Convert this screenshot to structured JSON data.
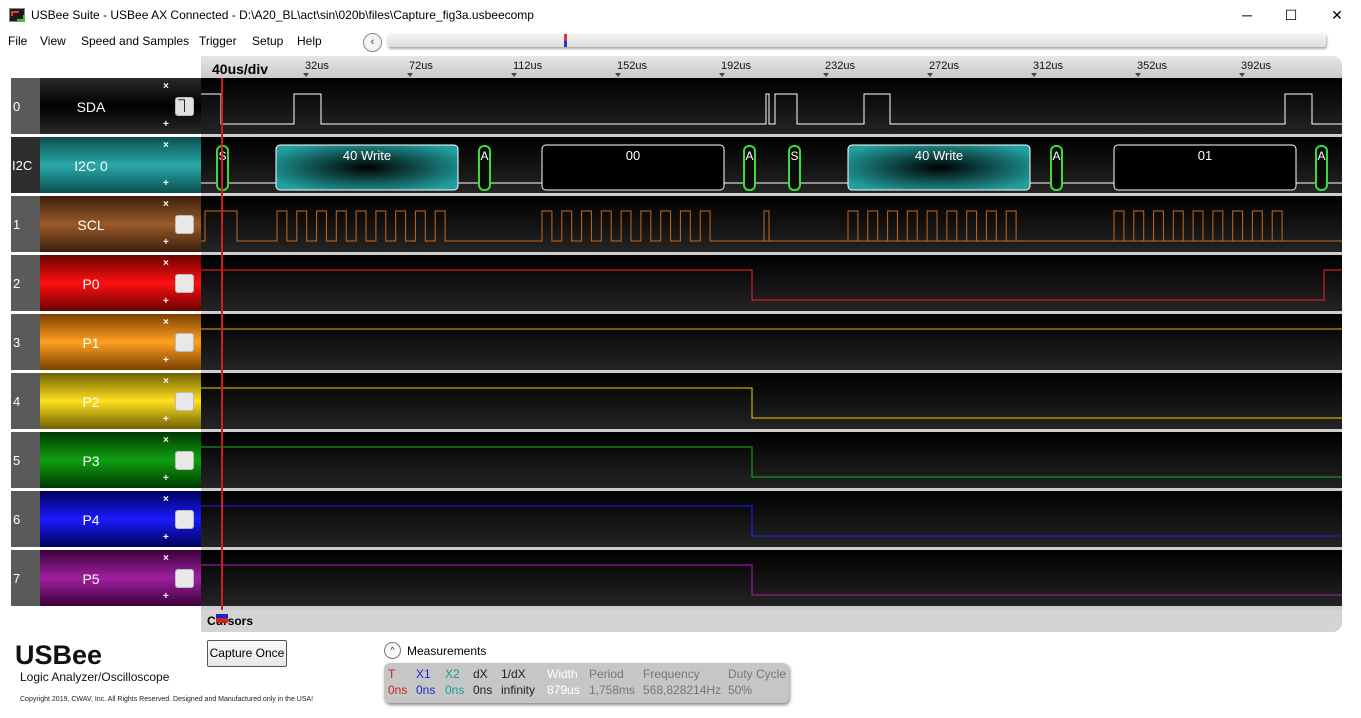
{
  "window": {
    "title": "USBee Suite - USBee AX Connected - D:\\A20_BL\\act\\sin\\020b\\files\\Capture_fig3a.usbeecomp",
    "minimize": "─",
    "maximize": "☐",
    "close": "✕"
  },
  "menu": [
    "File",
    "View",
    "Speed and Samples",
    "Trigger",
    "Setup",
    "Help"
  ],
  "overview": {
    "scroll_left_icon": "‹"
  },
  "timebase": {
    "div_label": "40us/div",
    "ticks": [
      "32us",
      "72us",
      "112us",
      "152us",
      "192us",
      "232us",
      "272us",
      "312us",
      "352us",
      "392us"
    ]
  },
  "channels": [
    {
      "num": "0",
      "name": "SDA",
      "box": "⏋",
      "color": "#000000"
    },
    {
      "num": "I2C",
      "name": "I2C 0",
      "box": "",
      "color": "#1a9a9a"
    },
    {
      "num": "1",
      "name": "SCL",
      "box": "",
      "color": "#8b4513"
    },
    {
      "num": "2",
      "name": "P0",
      "box": "",
      "color": "#e00000"
    },
    {
      "num": "3",
      "name": "P1",
      "box": "",
      "color": "#ff8c00"
    },
    {
      "num": "4",
      "name": "P2",
      "box": "",
      "color": "#e8d000"
    },
    {
      "num": "5",
      "name": "P3",
      "box": "",
      "color": "#008000"
    },
    {
      "num": "6",
      "name": "P4",
      "box": "",
      "color": "#0000e0"
    },
    {
      "num": "7",
      "name": "P5",
      "box": "",
      "color": "#8b008b"
    }
  ],
  "channel_ctrl": {
    "remove": "×",
    "add": "+"
  },
  "i2c_packets": [
    {
      "label": "S",
      "kind": "start"
    },
    {
      "label": "40 Write",
      "kind": "address"
    },
    {
      "label": "A",
      "kind": "ack"
    },
    {
      "label": "00",
      "kind": "data"
    },
    {
      "label": "A",
      "kind": "ack"
    },
    {
      "label": "S",
      "kind": "start"
    },
    {
      "label": "40 Write",
      "kind": "address"
    },
    {
      "label": "A",
      "kind": "ack"
    },
    {
      "label": "01",
      "kind": "data"
    },
    {
      "label": "A",
      "kind": "ack"
    }
  ],
  "cursors_label": "Cursors",
  "brand": {
    "name": "USBee",
    "subtitle": "Logic Analyzer/Oscilloscope",
    "copyright": "Copyright 2019, CWAV, Inc. All Rights Reserved. Designed and Manufactured only in the USA!"
  },
  "capture_button": "Capture Once",
  "measurements": {
    "title": "Measurements",
    "toggle_icon": "^",
    "columns": [
      {
        "head": "T",
        "value": "0ns",
        "color": "#cc2222"
      },
      {
        "head": "X1",
        "value": "0ns",
        "color": "#2222cc"
      },
      {
        "head": "X2",
        "value": "0ns",
        "color": "#1a9a9a"
      },
      {
        "head": "dX",
        "value": "0ns",
        "color": "#222222"
      },
      {
        "head": "1/dX",
        "value": "infinity",
        "color": "#222222"
      },
      {
        "head": "Width",
        "value": "879us",
        "color": "#ffffff"
      },
      {
        "head": "Period",
        "value": "1,758ms",
        "color": "#777777"
      },
      {
        "head": "Frequency",
        "value": "568,828214Hz",
        "color": "#777777"
      },
      {
        "head": "Duty Cycle",
        "value": "50%",
        "color": "#777777"
      }
    ]
  }
}
